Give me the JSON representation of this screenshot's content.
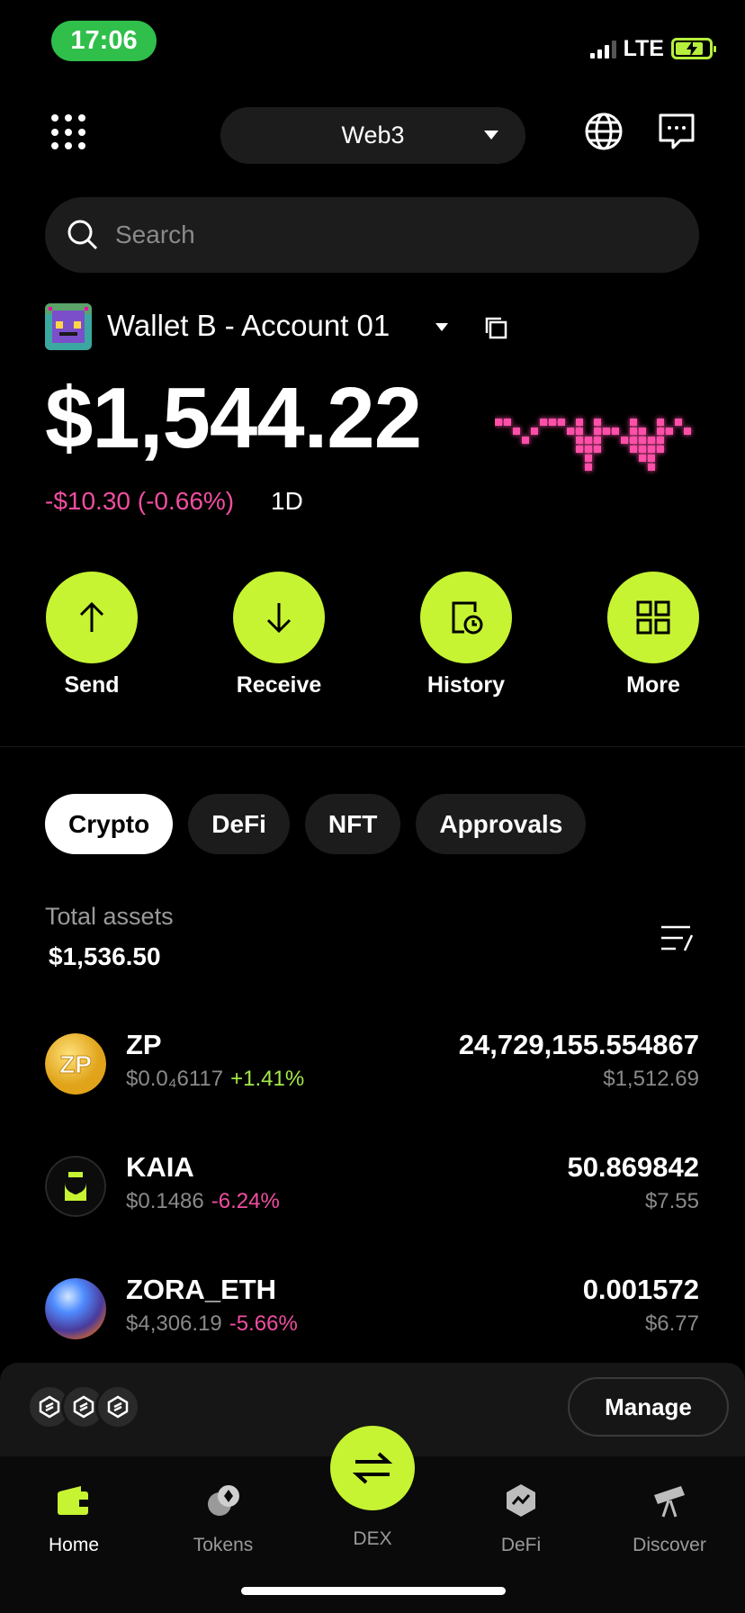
{
  "status_bar": {
    "time": "17:06",
    "network": "LTE"
  },
  "header": {
    "network_selector": "Web3"
  },
  "search": {
    "placeholder": "Search"
  },
  "account": {
    "name": "Wallet B - Account 01",
    "balance": "$1,544.22",
    "change": "-$10.30 (-0.66%)",
    "period": "1D",
    "change_color": "#f04ea0"
  },
  "actions": [
    {
      "label": "Send",
      "icon": "arrow-up-icon"
    },
    {
      "label": "Receive",
      "icon": "arrow-down-icon"
    },
    {
      "label": "History",
      "icon": "history-icon"
    },
    {
      "label": "More",
      "icon": "grid-icon"
    }
  ],
  "tabs": [
    "Crypto",
    "DeFi",
    "NFT",
    "Approvals"
  ],
  "assets": {
    "total_label": "Total assets",
    "total_value": "$1,536.50"
  },
  "tokens": [
    {
      "symbol": "ZP",
      "price": "$0.0₄6117",
      "change": "+1.41%",
      "quantity": "24,729,155.554867",
      "value": "$1,512.69"
    },
    {
      "symbol": "KAIA",
      "price": "$0.1486",
      "change": "-6.24%",
      "quantity": "50.869842",
      "value": "$7.55"
    },
    {
      "symbol": "ZORA_ETH",
      "price": "$4,306.19",
      "change": "-5.66%",
      "quantity": "0.001572",
      "value": "$6.77"
    }
  ],
  "manage": {
    "label": "Manage"
  },
  "nav": [
    {
      "label": "Home",
      "icon": "wallet-icon"
    },
    {
      "label": "Tokens",
      "icon": "tokens-icon"
    },
    {
      "label": "DEX",
      "icon": "swap-icon"
    },
    {
      "label": "DeFi",
      "icon": "defi-icon"
    },
    {
      "label": "Discover",
      "icon": "telescope-icon"
    }
  ],
  "colors": {
    "accent": "#c6f432",
    "negative": "#f04ea0",
    "positive": "#a3e84a"
  }
}
